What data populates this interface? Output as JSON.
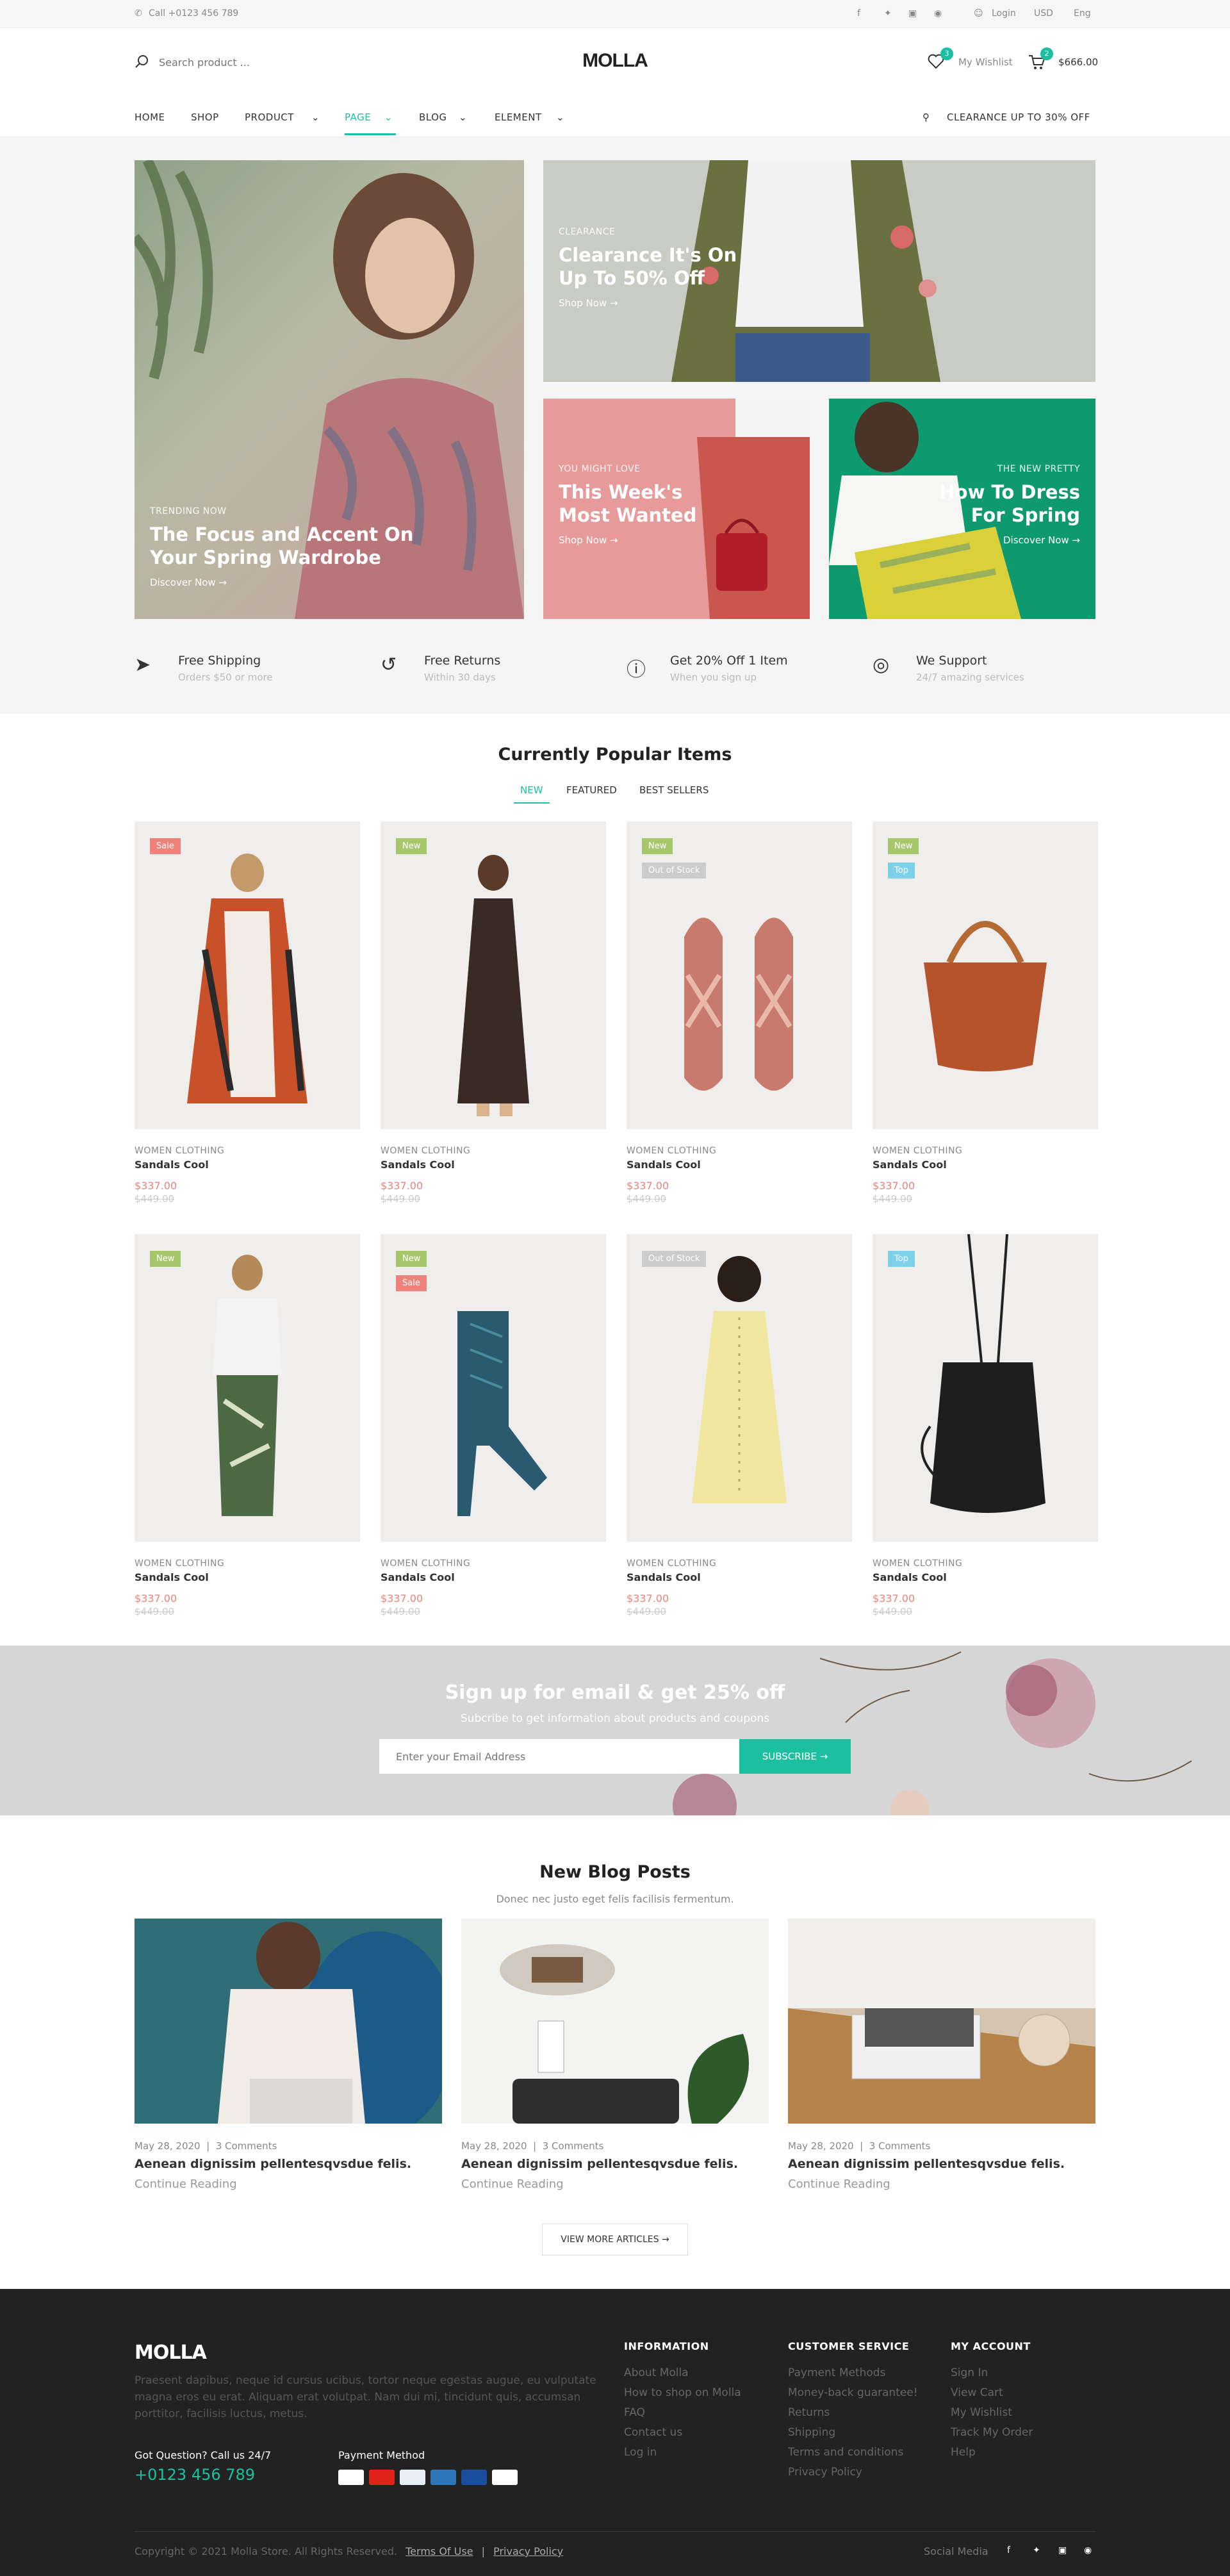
{
  "topbar": {
    "phone": "Call +0123 456 789",
    "login": "Login",
    "currency": "USD",
    "language": "Eng"
  },
  "header": {
    "logo": "MOLLA",
    "search_placeholder": "Search product ...",
    "wishlist": "My Wishlist",
    "wishlist_count": "3",
    "cart_count": "2",
    "cart_total": "$666.00"
  },
  "nav": {
    "items": [
      "HOME",
      "SHOP",
      "PRODUCT",
      "PAGE",
      "BLOG",
      "ELEMENT"
    ],
    "promo": "CLEARANCE UP TO 30% OFF"
  },
  "banners": [
    {
      "small": "TRENDING NOW",
      "title": "The Focus and Accent On Your Spring Wardrobe",
      "link": "Discover Now →"
    },
    {
      "small": "CLEARANCE",
      "title": "Clearance It's On Up To 50% Off",
      "link": "Shop Now →"
    },
    {
      "small": "YOU MIGHT LOVE",
      "title": "This Week's Most Wanted",
      "link": "Shop Now →"
    },
    {
      "small": "THE NEW PRETTY",
      "title": "How To Dress For Spring",
      "link": "Discover Now →"
    }
  ],
  "features": [
    {
      "title": "Free Shipping",
      "sub": "Orders $50 or more"
    },
    {
      "title": "Free Returns",
      "sub": "Within 30 days"
    },
    {
      "title": "Get 20% Off 1 Item",
      "sub": "When you sign up"
    },
    {
      "title": "We Support",
      "sub": "24/7 amazing services"
    }
  ],
  "popular": {
    "title": "Currently Popular Items",
    "tabs": [
      "NEW",
      "FEATURED",
      "BEST SELLERS"
    ]
  },
  "products": [
    {
      "cat": "WOMEN CLOTHING",
      "name": "Sandals Cool",
      "price": "$337.00",
      "old": "$449.00",
      "badges": [
        "Sale"
      ]
    },
    {
      "cat": "WOMEN CLOTHING",
      "name": "Sandals Cool",
      "price": "$337.00",
      "old": "$449.00",
      "badges": [
        "New"
      ]
    },
    {
      "cat": "WOMEN CLOTHING",
      "name": "Sandals Cool",
      "price": "$337.00",
      "old": "$449.00",
      "badges": [
        "New",
        "Out of Stock"
      ]
    },
    {
      "cat": "WOMEN CLOTHING",
      "name": "Sandals Cool",
      "price": "$337.00",
      "old": "$449.00",
      "badges": [
        "New",
        "Top"
      ]
    },
    {
      "cat": "WOMEN CLOTHING",
      "name": "Sandals Cool",
      "price": "$337.00",
      "old": "$449.00",
      "badges": [
        "New"
      ]
    },
    {
      "cat": "WOMEN CLOTHING",
      "name": "Sandals Cool",
      "price": "$337.00",
      "old": "$449.00",
      "badges": [
        "New",
        "Sale"
      ]
    },
    {
      "cat": "WOMEN CLOTHING",
      "name": "Sandals Cool",
      "price": "$337.00",
      "old": "$449.00",
      "badges": [
        "Out of Stock"
      ]
    },
    {
      "cat": "WOMEN CLOTHING",
      "name": "Sandals Cool",
      "price": "$337.00",
      "old": "$449.00",
      "badges": [
        "Top"
      ]
    }
  ],
  "badge_colors": {
    "Sale": "#ef837b",
    "New": "#a6c76c",
    "Out of Stock": "#cccccc",
    "Top": "#7dd2ea"
  },
  "newsletter": {
    "title": "Sign up for email & get 25% off",
    "sub": "Subcribe to get information about products and coupons",
    "placeholder": "Enter your Email Address",
    "button": "SUBSCRIBE →"
  },
  "blog": {
    "title": "New Blog Posts",
    "sub": "Donec nec justo eget felis facilisis fermentum.",
    "posts": [
      {
        "date": "May 28, 2020",
        "comments": "3 Comments",
        "title": "Aenean dignissim pellentesqvsdue felis.",
        "read": "Continue Reading"
      },
      {
        "date": "May 28, 2020",
        "comments": "3 Comments",
        "title": "Aenean dignissim pellentesqvsdue felis.",
        "read": "Continue Reading"
      },
      {
        "date": "May 28, 2020",
        "comments": "3 Comments",
        "title": "Aenean dignissim pellentesqvsdue felis.",
        "read": "Continue Reading"
      }
    ],
    "more": "VIEW MORE ARTICLES →"
  },
  "footer": {
    "logo": "MOLLA",
    "about": "Praesent dapibus, neque id cursus ucibus, tortor neque egestas augue, eu vulputate magna eros eu erat. Aliquam erat volutpat. Nam dui mi, tincidunt quis, accumsan porttitor, facilisis luctus, metus.",
    "question": "Got Question? Call us 24/7",
    "phone": "+0123 456 789",
    "payment": "Payment Method",
    "cols": [
      {
        "title": "INFORMATION",
        "links": [
          "About Molla",
          "How to shop on Molla",
          "FAQ",
          "Contact us",
          "Log in"
        ]
      },
      {
        "title": "CUSTOMER SERVICE",
        "links": [
          "Payment Methods",
          "Money-back guarantee!",
          "Returns",
          "Shipping",
          "Terms and conditions",
          "Privacy Policy"
        ]
      },
      {
        "title": "MY ACCOUNT",
        "links": [
          "Sign In",
          "View Cart",
          "My Wishlist",
          "Track My Order",
          "Help"
        ]
      }
    ],
    "copyright": "Copyright © 2021 Molla Store. All Rights Reserved.",
    "terms": "Terms Of Use",
    "privacy": "Privacy Policy",
    "social": "Social Media"
  },
  "colors": {
    "accent": "#1cc0a0",
    "sale": "#ef837b",
    "footer_bg": "#222222"
  }
}
